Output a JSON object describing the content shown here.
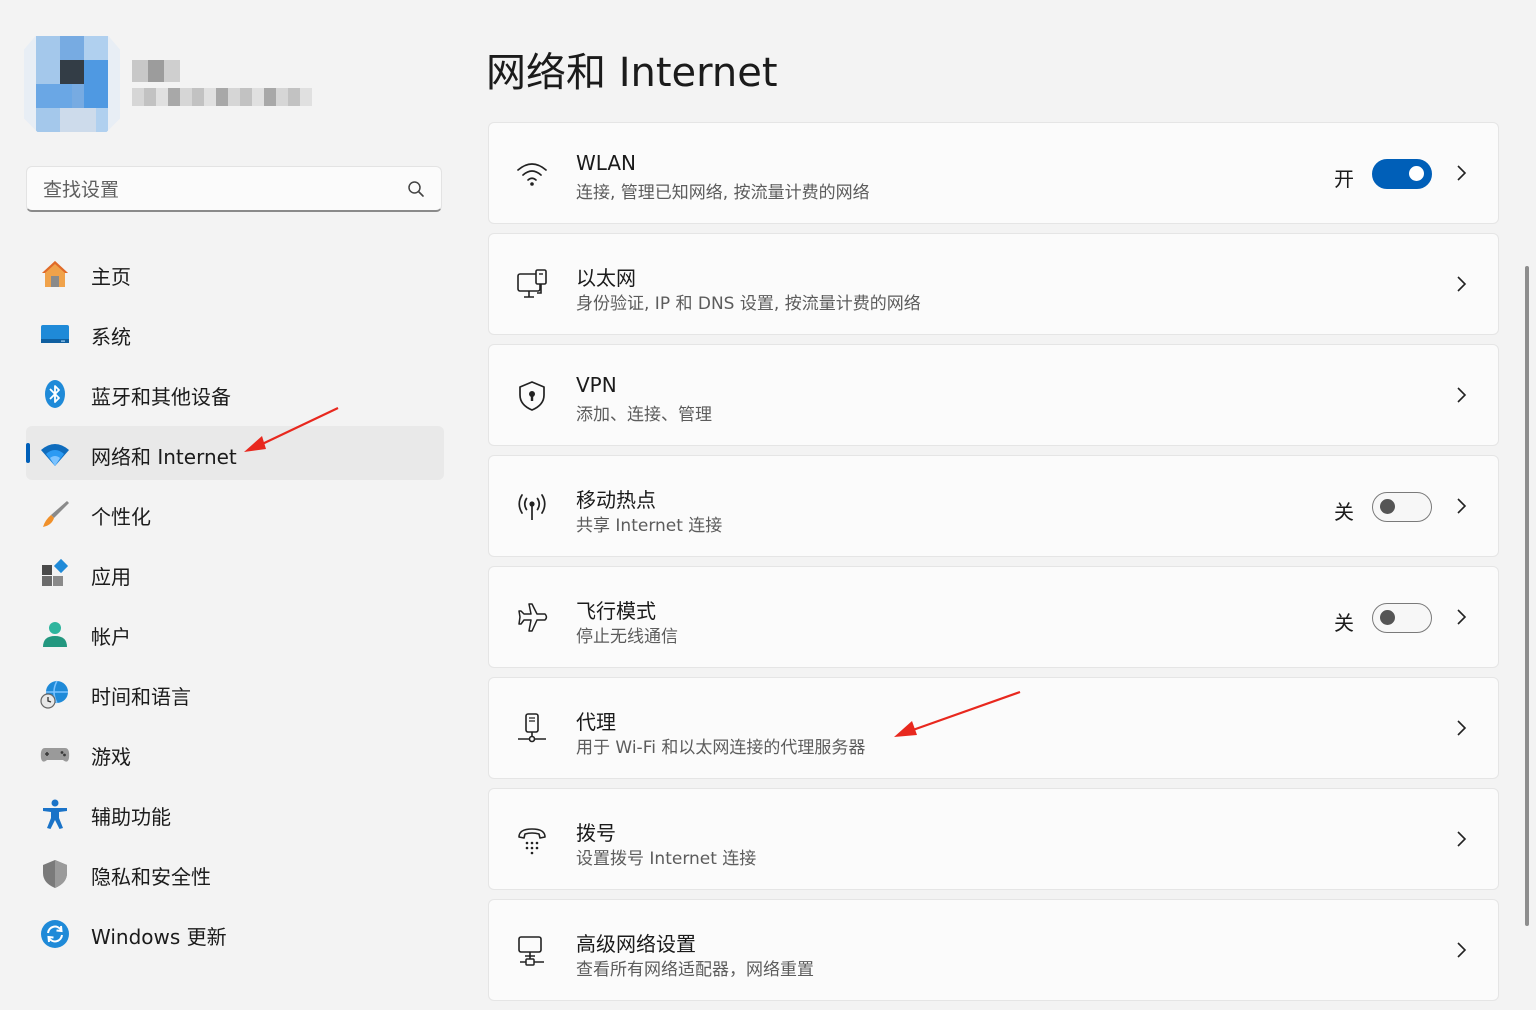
{
  "user": {
    "name": "",
    "email": ""
  },
  "search": {
    "placeholder": "查找设置"
  },
  "sidebar": {
    "items": [
      {
        "label": "主页",
        "icon": "home-icon",
        "selected": false
      },
      {
        "label": "系统",
        "icon": "monitor-icon",
        "selected": false
      },
      {
        "label": "蓝牙和其他设备",
        "icon": "bluetooth-icon",
        "selected": false
      },
      {
        "label": "网络和 Internet",
        "icon": "wifi-icon",
        "selected": true
      },
      {
        "label": "个性化",
        "icon": "brush-icon",
        "selected": false
      },
      {
        "label": "应用",
        "icon": "apps-icon",
        "selected": false
      },
      {
        "label": "帐户",
        "icon": "person-icon",
        "selected": false
      },
      {
        "label": "时间和语言",
        "icon": "globe-clock-icon",
        "selected": false
      },
      {
        "label": "游戏",
        "icon": "gamepad-icon",
        "selected": false
      },
      {
        "label": "辅助功能",
        "icon": "accessibility-icon",
        "selected": false
      },
      {
        "label": "隐私和安全性",
        "icon": "shield-icon",
        "selected": false
      },
      {
        "label": "Windows 更新",
        "icon": "update-icon",
        "selected": false
      }
    ]
  },
  "main": {
    "title": "网络和 Internet",
    "cards": [
      {
        "title": "WLAN",
        "subtitle": "连接, 管理已知网络, 按流量计费的网络",
        "icon": "wifi-outline-icon",
        "toggle": {
          "state": "开",
          "on": true
        }
      },
      {
        "title": "以太网",
        "subtitle": "身份验证, IP 和 DNS 设置, 按流量计费的网络",
        "icon": "ethernet-icon"
      },
      {
        "title": "VPN",
        "subtitle": "添加、连接、管理",
        "icon": "vpn-shield-icon"
      },
      {
        "title": "移动热点",
        "subtitle": "共享 Internet 连接",
        "icon": "hotspot-icon",
        "toggle": {
          "state": "关",
          "on": false
        }
      },
      {
        "title": "飞行模式",
        "subtitle": "停止无线通信",
        "icon": "airplane-icon",
        "toggle": {
          "state": "关",
          "on": false
        }
      },
      {
        "title": "代理",
        "subtitle": "用于 Wi-Fi 和以太网连接的代理服务器",
        "icon": "proxy-icon"
      },
      {
        "title": "拨号",
        "subtitle": "设置拨号 Internet 连接",
        "icon": "dialup-icon"
      },
      {
        "title": "高级网络设置",
        "subtitle": "查看所有网络适配器，网络重置",
        "icon": "advanced-network-icon"
      }
    ]
  },
  "colors": {
    "accent": "#005fb8",
    "annotation_arrow": "#e8281e",
    "background": "#f3f3f3",
    "card": "#fbfbfb"
  }
}
